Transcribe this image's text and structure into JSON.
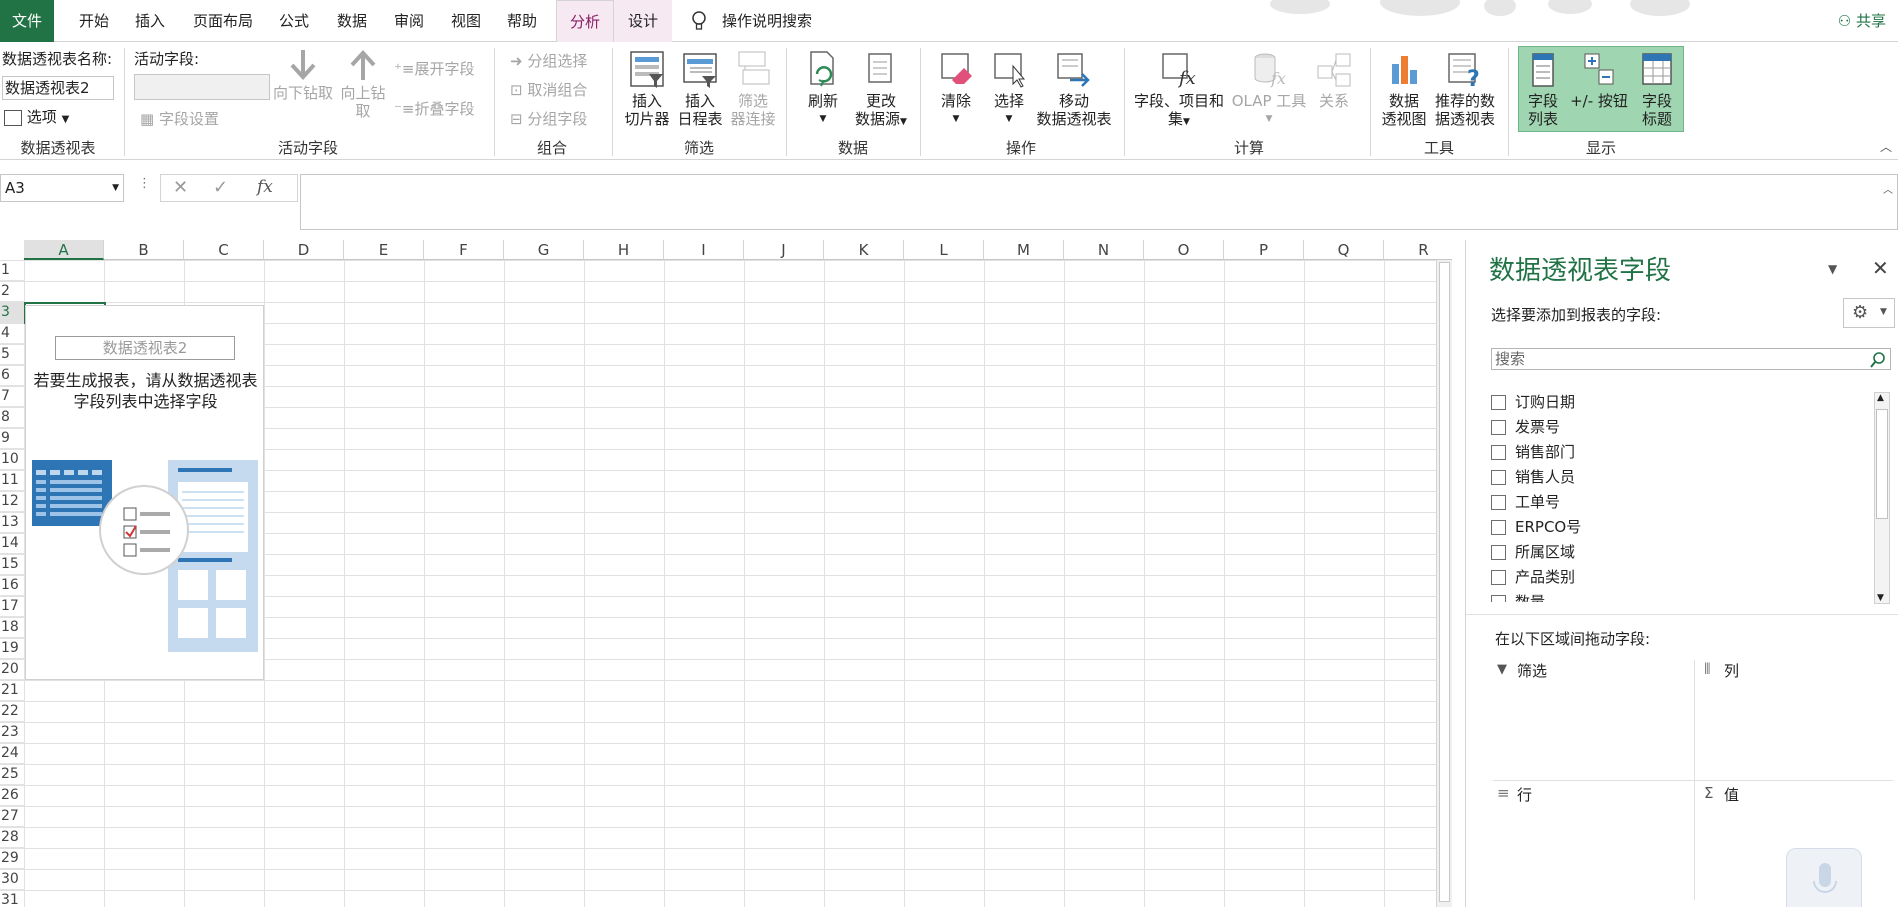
{
  "tabs": {
    "file": "文件",
    "home": "开始",
    "insert": "插入",
    "layout": "页面布局",
    "formulas": "公式",
    "data": "数据",
    "review": "审阅",
    "view": "视图",
    "help": "帮助",
    "analyze": "分析",
    "design": "设计",
    "tell_me": "操作说明搜索",
    "share": "共享"
  },
  "ribbon": {
    "pivot_name_label": "数据透视表名称:",
    "pivot_name_value": "数据透视表2",
    "options": "选项",
    "group_pivot": "数据透视表",
    "active_field_label": "活动字段:",
    "field_settings": "字段设置",
    "drill_down": "向下钻取",
    "drill_up_1": "向上钻",
    "drill_up_2": "取",
    "expand_field": "展开字段",
    "collapse_field": "折叠字段",
    "group_active_field": "活动字段",
    "group_selection": "分组选择",
    "ungroup": "取消组合",
    "group_field": "分组字段",
    "group_group": "组合",
    "insert_slicer_1": "插入",
    "insert_slicer_2": "切片器",
    "insert_timeline_1": "插入",
    "insert_timeline_2": "日程表",
    "filter_conn_1": "筛选",
    "filter_conn_2": "器连接",
    "group_filter": "筛选",
    "refresh": "刷新",
    "change_source_1": "更改",
    "change_source_2": "数据源",
    "group_data": "数据",
    "clear": "清除",
    "select": "选择",
    "move_pivot_1": "移动",
    "move_pivot_2": "数据透视表",
    "group_actions": "操作",
    "fields_items_1": "字段、项目和",
    "fields_items_2": "集",
    "olap_tools": "OLAP 工具",
    "relationships": "关系",
    "group_calc": "计算",
    "pivot_chart_1": "数据",
    "pivot_chart_2": "透视图",
    "recommended_1": "推荐的数",
    "recommended_2": "据透视表",
    "group_tools": "工具",
    "field_list_1": "字段",
    "field_list_2": "列表",
    "plus_minus": "+/- 按钮",
    "field_headers_1": "字段",
    "field_headers_2": "标题",
    "group_show": "显示"
  },
  "formula_bar": {
    "name_box": "A3",
    "fx": "fx"
  },
  "columns": [
    "A",
    "B",
    "C",
    "D",
    "E",
    "F",
    "G",
    "H",
    "I",
    "J",
    "K",
    "L",
    "M",
    "N",
    "O",
    "P",
    "Q",
    "R"
  ],
  "rows": [
    "1",
    "2",
    "3",
    "4",
    "5",
    "6",
    "7",
    "8",
    "9",
    "10",
    "11",
    "12",
    "13",
    "14",
    "15",
    "16",
    "17",
    "18",
    "19",
    "20",
    "21",
    "22",
    "23",
    "24",
    "25",
    "26",
    "27",
    "28",
    "29",
    "30",
    "31"
  ],
  "pivot_placeholder": {
    "name": "数据透视表2",
    "message": "若要生成报表，请从数据透视表字段列表中选择字段"
  },
  "pane": {
    "title": "数据透视表字段",
    "subtitle": "选择要添加到报表的字段:",
    "search_placeholder": "搜索",
    "fields": [
      "订购日期",
      "发票号",
      "销售部门",
      "销售人员",
      "工单号",
      "ERPCO号",
      "所属区域",
      "产品类别",
      "数量"
    ],
    "areas_label": "在以下区域间拖动字段:",
    "filters": "筛选",
    "columns": "列",
    "rows": "行",
    "values": "值"
  },
  "colors": {
    "accent": "#217346",
    "context_tab": "#8b1e66"
  }
}
